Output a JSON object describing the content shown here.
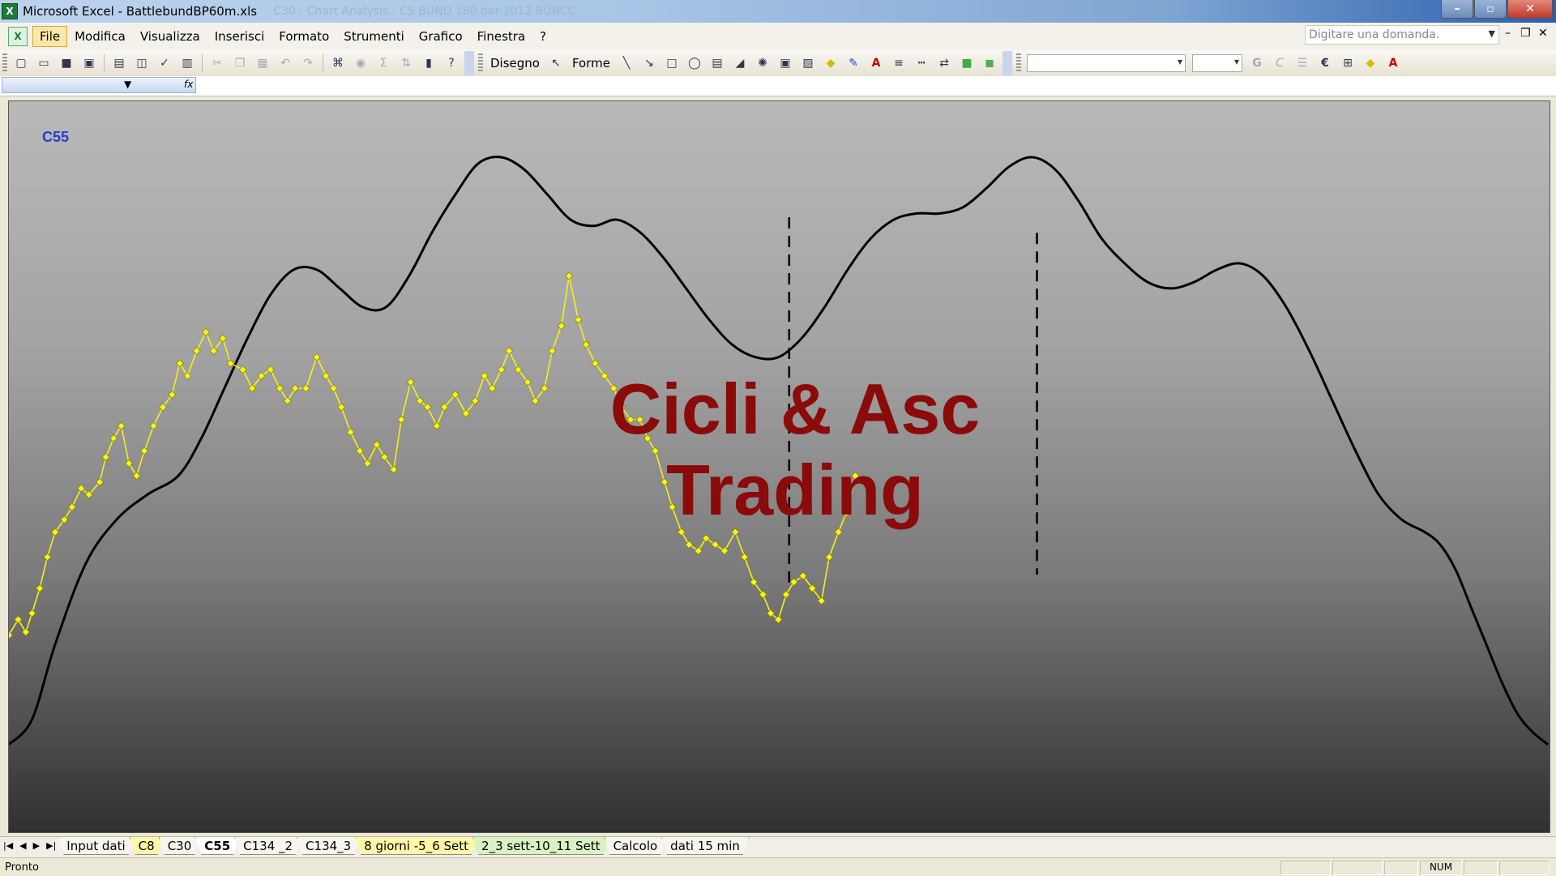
{
  "window": {
    "title": "Microsoft Excel - BattlebundBP60m.xls",
    "background_title": "C30 - Chart Analysis - CS BUND 180 bar 2012 BUNCC",
    "app_icon_letter": "X",
    "buttons": {
      "minimize": "–",
      "restore": "▫",
      "close": "✕"
    }
  },
  "menubar": {
    "items": [
      {
        "label": "File",
        "active": true
      },
      {
        "label": "Modifica"
      },
      {
        "label": "Visualizza"
      },
      {
        "label": "Inserisci"
      },
      {
        "label": "Formato"
      },
      {
        "label": "Strumenti"
      },
      {
        "label": "Grafico"
      },
      {
        "label": "Finestra"
      },
      {
        "label": "?"
      }
    ],
    "ask_placeholder": "Digitare una domanda.",
    "doc_buttons": {
      "minimize": "–",
      "restore": "❐",
      "close": "✕"
    }
  },
  "toolbar": {
    "drawing_label": "Disegno",
    "shapes_label": "Forme",
    "standard_icons": [
      "new-icon",
      "open-icon",
      "save-icon",
      "permission-icon",
      "print-icon",
      "print-preview-icon",
      "spelling-icon",
      "research-icon",
      "cut-icon",
      "copy-icon",
      "paste-icon",
      "undo-icon",
      "redo-icon",
      "hyperlink-icon",
      "autosum-icon",
      "sort-icon",
      "chart-wizard-icon",
      "help-icon"
    ],
    "format_icons": [
      "bold-icon",
      "italic-icon",
      "align-icon",
      "euro-icon",
      "borders-icon",
      "fill-color-icon",
      "font-color-icon"
    ]
  },
  "formula_bar": {
    "name_box": "",
    "fx": "fx"
  },
  "chart": {
    "sheet_label": "C55",
    "watermark_line1": "Cicli & Asc",
    "watermark_line2": "Trading",
    "colors": {
      "price": "#f5ef1c",
      "price_marker_fill": "#f8f41c",
      "price_marker_stroke": "#8a8500",
      "cycle": "#000000",
      "watermark": "#8b0a0a",
      "label": "#2a3bd0"
    }
  },
  "chart_data": {
    "type": "line",
    "note": "",
    "x_range": [
      0,
      100
    ],
    "y_range": [
      0,
      100
    ],
    "series": [
      {
        "kind": "price",
        "points": [
          [
            0,
            23.5
          ],
          [
            0.6,
            26
          ],
          [
            1.1,
            24
          ],
          [
            1.5,
            27
          ],
          [
            2,
            31
          ],
          [
            2.5,
            36
          ],
          [
            3,
            40
          ],
          [
            3.6,
            42
          ],
          [
            4.1,
            44
          ],
          [
            4.7,
            47
          ],
          [
            5.2,
            46
          ],
          [
            5.9,
            48
          ],
          [
            6.3,
            52
          ],
          [
            6.8,
            55
          ],
          [
            7.3,
            57
          ],
          [
            7.8,
            51
          ],
          [
            8.3,
            49
          ],
          [
            8.8,
            53
          ],
          [
            9.4,
            57
          ],
          [
            10,
            60
          ],
          [
            10.6,
            62
          ],
          [
            11.1,
            67
          ],
          [
            11.6,
            65
          ],
          [
            12.2,
            69
          ],
          [
            12.8,
            72
          ],
          [
            13.3,
            69
          ],
          [
            13.9,
            71
          ],
          [
            14.4,
            67
          ],
          [
            15.2,
            66
          ],
          [
            15.8,
            63
          ],
          [
            16.4,
            65
          ],
          [
            17,
            66
          ],
          [
            17.6,
            63
          ],
          [
            18.1,
            61
          ],
          [
            18.6,
            63
          ],
          [
            19.3,
            63
          ],
          [
            20,
            68
          ],
          [
            20.6,
            65
          ],
          [
            21.1,
            63
          ],
          [
            21.6,
            60
          ],
          [
            22.2,
            56
          ],
          [
            22.8,
            53
          ],
          [
            23.3,
            51
          ],
          [
            23.9,
            54
          ],
          [
            24.4,
            52
          ],
          [
            25,
            50
          ],
          [
            25.5,
            58
          ],
          [
            26.1,
            64
          ],
          [
            26.7,
            61
          ],
          [
            27.2,
            60
          ],
          [
            27.8,
            57
          ],
          [
            28.3,
            60
          ],
          [
            29,
            62
          ],
          [
            29.7,
            59
          ],
          [
            30.3,
            61
          ],
          [
            30.9,
            65
          ],
          [
            31.4,
            63
          ],
          [
            32,
            66
          ],
          [
            32.5,
            69
          ],
          [
            33.1,
            66
          ],
          [
            33.7,
            64
          ],
          [
            34.2,
            61
          ],
          [
            34.8,
            63
          ],
          [
            35.3,
            69
          ],
          [
            35.9,
            73
          ],
          [
            36.4,
            81
          ],
          [
            37,
            74
          ],
          [
            37.5,
            70
          ],
          [
            38.1,
            67
          ],
          [
            38.7,
            65
          ],
          [
            39.3,
            63
          ],
          [
            39.8,
            60
          ],
          [
            40.4,
            58
          ],
          [
            41,
            58
          ],
          [
            41.5,
            55
          ],
          [
            42,
            53
          ],
          [
            42.6,
            48
          ],
          [
            43.1,
            44
          ],
          [
            43.7,
            40
          ],
          [
            44.2,
            38
          ],
          [
            44.8,
            37
          ],
          [
            45.3,
            39
          ],
          [
            45.9,
            38
          ],
          [
            46.5,
            37
          ],
          [
            47.2,
            40
          ],
          [
            47.8,
            36
          ],
          [
            48.4,
            32
          ],
          [
            49,
            30
          ],
          [
            49.5,
            27
          ],
          [
            50,
            26
          ],
          [
            50.5,
            30
          ],
          [
            51,
            32
          ],
          [
            51.6,
            33
          ],
          [
            52.2,
            31
          ],
          [
            52.8,
            29
          ],
          [
            53.3,
            36
          ],
          [
            53.9,
            40
          ],
          [
            54.4,
            43
          ],
          [
            55,
            49
          ]
        ]
      },
      {
        "kind": "cycle",
        "points": [
          [
            0,
            6
          ],
          [
            1.5,
            10
          ],
          [
            3,
            22
          ],
          [
            5,
            35
          ],
          [
            7,
            42
          ],
          [
            9,
            46
          ],
          [
            11,
            49
          ],
          [
            12.5,
            55
          ],
          [
            14,
            63
          ],
          [
            15.5,
            71
          ],
          [
            17,
            78
          ],
          [
            18.5,
            82
          ],
          [
            20,
            82
          ],
          [
            21.5,
            79
          ],
          [
            23,
            76
          ],
          [
            24.5,
            76
          ],
          [
            26,
            81
          ],
          [
            27.5,
            88
          ],
          [
            29,
            94
          ],
          [
            30.5,
            99
          ],
          [
            32,
            100
          ],
          [
            33.5,
            98
          ],
          [
            35,
            94
          ],
          [
            36.5,
            90
          ],
          [
            38,
            89
          ],
          [
            39.5,
            90
          ],
          [
            41,
            88
          ],
          [
            42.5,
            84
          ],
          [
            44,
            79
          ],
          [
            45.5,
            74
          ],
          [
            47,
            70
          ],
          [
            48.5,
            68
          ],
          [
            50,
            68
          ],
          [
            51.5,
            71
          ],
          [
            53,
            76
          ],
          [
            54.5,
            82
          ],
          [
            56,
            87
          ],
          [
            57.5,
            90
          ],
          [
            59,
            91
          ],
          [
            60.5,
            91
          ],
          [
            62,
            92
          ],
          [
            63.5,
            95
          ],
          [
            65,
            98.5
          ],
          [
            66.5,
            100
          ],
          [
            68,
            98
          ],
          [
            69.5,
            93
          ],
          [
            71,
            87
          ],
          [
            72.5,
            83
          ],
          [
            74,
            80
          ],
          [
            75.5,
            79
          ],
          [
            77,
            80
          ],
          [
            78.5,
            82
          ],
          [
            80,
            83
          ],
          [
            81.5,
            81
          ],
          [
            83,
            76
          ],
          [
            84.5,
            69
          ],
          [
            86,
            61
          ],
          [
            87.5,
            53
          ],
          [
            89,
            46
          ],
          [
            90.5,
            42
          ],
          [
            92,
            40
          ],
          [
            93,
            38
          ],
          [
            94,
            34
          ],
          [
            95,
            28
          ],
          [
            96,
            22
          ],
          [
            97,
            16
          ],
          [
            98,
            11
          ],
          [
            99,
            8
          ],
          [
            100,
            6
          ]
        ]
      }
    ],
    "vlines": [
      [
        50.7,
        90.4,
        31.3
      ],
      [
        66.8,
        87.9,
        33.2
      ]
    ]
  },
  "sheet_tabs": [
    {
      "label": "Input dati",
      "style": "normal"
    },
    {
      "label": "C8",
      "style": "yellow"
    },
    {
      "label": "C30",
      "style": "normal"
    },
    {
      "label": "C55",
      "style": "active"
    },
    {
      "label": "C134 _2",
      "style": "normal"
    },
    {
      "label": "C134_3",
      "style": "normal"
    },
    {
      "label": "8 giorni -5_6 Sett",
      "style": "yellow"
    },
    {
      "label": "2_3 sett-10_11 Sett",
      "style": "green"
    },
    {
      "label": "Calcolo",
      "style": "normal"
    },
    {
      "label": "dati 15 min",
      "style": "normal"
    }
  ],
  "status": {
    "text": "Pronto",
    "num": "NUM"
  }
}
